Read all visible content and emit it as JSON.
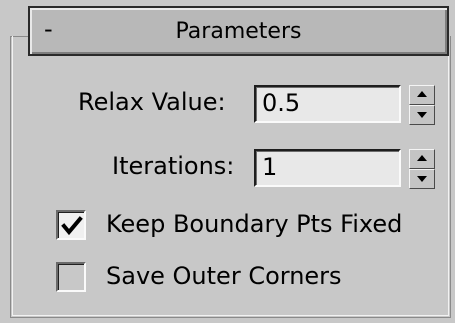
{
  "rollout": {
    "collapse_symbol": "-",
    "title": "Parameters"
  },
  "params": {
    "relax_value": {
      "label": "Relax Value:",
      "value": "0.5"
    },
    "iterations": {
      "label": "Iterations:",
      "value": "1"
    }
  },
  "options": {
    "keep_boundary": {
      "label": "Keep Boundary Pts Fixed",
      "checked": true
    },
    "save_outer_corners": {
      "label": "Save Outer Corners",
      "checked": false
    }
  },
  "icons": {
    "spinner_up": "triangle-up-icon",
    "spinner_down": "triangle-down-icon",
    "check": "checkmark-icon"
  },
  "colors": {
    "panel_bg": "#c8c8c8",
    "header_bg": "#b8b8b8",
    "field_bg": "#e8e8e8"
  }
}
